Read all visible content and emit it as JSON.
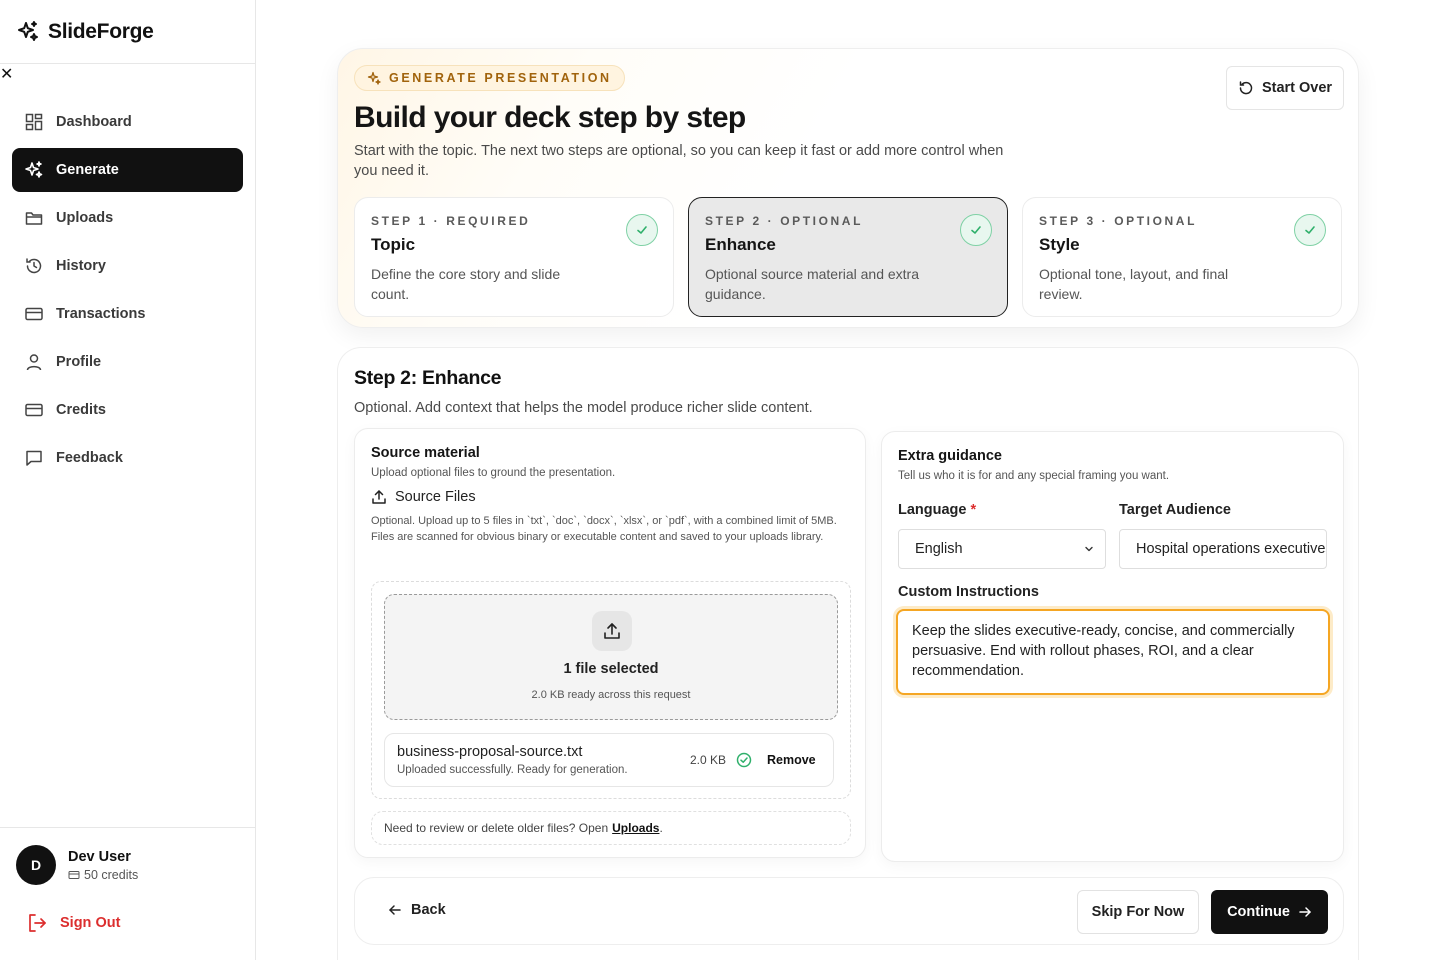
{
  "app": {
    "name": "SlideForge"
  },
  "sidebar": {
    "items": [
      {
        "label": "Dashboard",
        "icon": "dashboard-icon"
      },
      {
        "label": "Generate",
        "icon": "sparkle-icon",
        "active": true
      },
      {
        "label": "Uploads",
        "icon": "folder-icon"
      },
      {
        "label": "History",
        "icon": "history-icon"
      },
      {
        "label": "Transactions",
        "icon": "card-icon"
      },
      {
        "label": "Profile",
        "icon": "user-icon"
      },
      {
        "label": "Credits",
        "icon": "card-icon"
      },
      {
        "label": "Feedback",
        "icon": "chat-icon"
      }
    ],
    "user": {
      "initial": "D",
      "name": "Dev User",
      "credits": "50 credits"
    },
    "sign_out": "Sign Out"
  },
  "hero": {
    "badge": "GENERATE PRESENTATION",
    "title": "Build your deck step by step",
    "subtitle": "Start with the topic. The next two steps are optional, so you can keep it fast or add more control when you need it.",
    "start_over": "Start Over",
    "steps": [
      {
        "kicker": "STEP 1 · REQUIRED",
        "title": "Topic",
        "desc": "Define the core story and slide count."
      },
      {
        "kicker": "STEP 2 · OPTIONAL",
        "title": "Enhance",
        "desc": "Optional source material and extra guidance."
      },
      {
        "kicker": "STEP 3 · OPTIONAL",
        "title": "Style",
        "desc": "Optional tone, layout, and final review."
      }
    ]
  },
  "enhance": {
    "title": "Step 2: Enhance",
    "subtitle": "Optional. Add context that helps the model produce richer slide content.",
    "source": {
      "title": "Source material",
      "subtitle": "Upload optional files to ground the presentation.",
      "files_heading": "Source Files",
      "files_note": "Optional. Upload up to 5 files in `txt`, `doc`, `docx`, `xlsx`, or `pdf`, with a combined limit of 5MB. Files are scanned for obvious binary or executable content and saved to your uploads library.",
      "dropzone_title": "1 file selected",
      "dropzone_sub": "2.0 KB ready across this request",
      "file": {
        "name": "business-proposal-source.txt",
        "status": "Uploaded successfully. Ready for generation.",
        "size": "2.0 KB",
        "remove": "Remove"
      },
      "footer_text": "Need to review or delete older files? Open",
      "footer_link": "Uploads",
      "footer_end": "."
    },
    "guidance": {
      "title": "Extra guidance",
      "subtitle": "Tell us who it is for and any special framing you want.",
      "language_label": "Language",
      "required_mark": "*",
      "language_value": "English",
      "audience_label": "Target Audience",
      "audience_value": "Hospital operations executives",
      "instructions_label": "Custom Instructions",
      "instructions_value": "Keep the slides executive-ready, concise, and commercially persuasive. End with rollout phases, ROI, and a clear recommendation."
    }
  },
  "footer": {
    "back": "Back",
    "skip": "Skip For Now",
    "continue": "Continue"
  },
  "colors": {
    "accent": "#111111",
    "warning": "#f5a623",
    "success": "#2fb06b",
    "danger": "#dc2e2e",
    "badge_text": "#a1630c"
  }
}
